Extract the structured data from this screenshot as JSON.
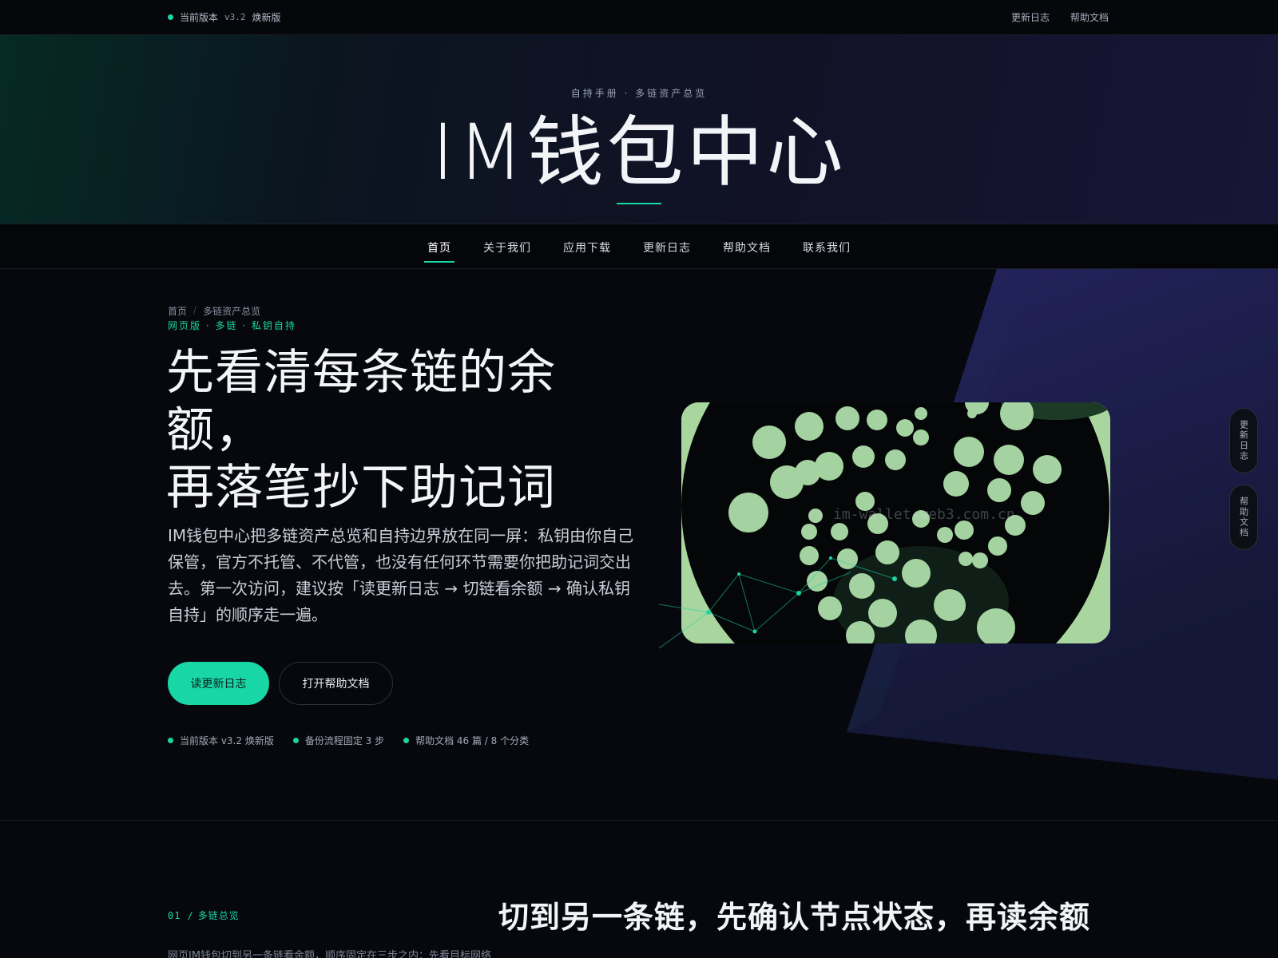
{
  "topbar": {
    "version_label": "当前版本",
    "version_number": "v3.2",
    "version_name": "焕新版",
    "links": [
      "更新日志",
      "帮助文档"
    ]
  },
  "banner": {
    "eyebrow": "自持手册 · 多链资产总览",
    "title": "IM钱包中心"
  },
  "nav": {
    "items": [
      "首页",
      "关于我们",
      "应用下载",
      "更新日志",
      "帮助文档",
      "联系我们"
    ],
    "active": "首页"
  },
  "hero": {
    "breadcrumb": [
      "首页",
      "多链资产总览"
    ],
    "tags": "网页版 · 多链 · 私钥自持",
    "title_line1": "先看清每条链的余额，",
    "title_line2": "再落笔抄下助记词",
    "lead": "IM钱包中心把多链资产总览和自持边界放在同一屏：私钥由你自己保管，官方不托管、不代管，也没有任何环节需要你把助记词交出去。第一次访问，建议按「读更新日志 → 切链看余额 → 确认私钥自持」的顺序走一遍。",
    "primary_button": "读更新日志",
    "secondary_button": "打开帮助文档",
    "stats": [
      "当前版本 v3.2 焕新版",
      "备份流程固定 3 步",
      "帮助文档 46 篇 / 8 个分类"
    ],
    "watermark": "im-wallet-web3.com.cn"
  },
  "rail": [
    "更新日志",
    "帮助文档"
  ],
  "section": {
    "label_num": "01 /",
    "label_text": "多链总览",
    "title": "切到另一条链，先确认节点状态，再读余额",
    "text": "网页IM钱包切到另一条链看余额，顺序固定在三步之内：先看目标网络"
  },
  "colors": {
    "accent": "#19d6a6",
    "background": "#07080d",
    "banner_violet": "#181536",
    "illustration_green": "#a9d69e"
  }
}
